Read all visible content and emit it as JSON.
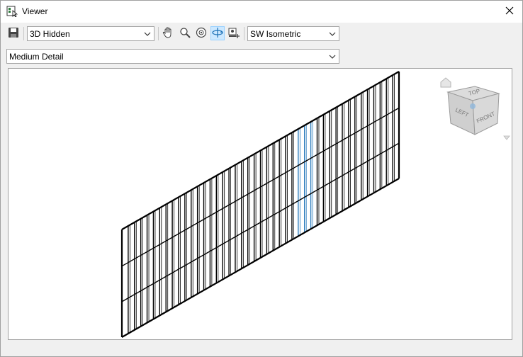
{
  "window": {
    "title": "Viewer",
    "title_icon": "viewer-app-icon",
    "close_icon": "close-icon"
  },
  "toolbar": {
    "save_icon": "save-icon",
    "visual_style": {
      "selected": "3D Hidden"
    },
    "nav_icons": [
      "pan-icon",
      "zoom-icon",
      "steering-wheel-icon",
      "orbit-icon",
      "camera-icon"
    ],
    "active_tool": "orbit-icon",
    "view": {
      "selected": "SW Isometric"
    }
  },
  "detail": {
    "selected": "Medium Detail"
  },
  "viewcube": {
    "top_label": "TOP",
    "left_label": "LEFT",
    "front_label": "FRONT",
    "home_icon": "home-icon",
    "menu_icon": "viewcube-menu-icon"
  },
  "model": {
    "description_icon": "curtain-wall-model",
    "highlight_color": "#2e7dbd"
  }
}
